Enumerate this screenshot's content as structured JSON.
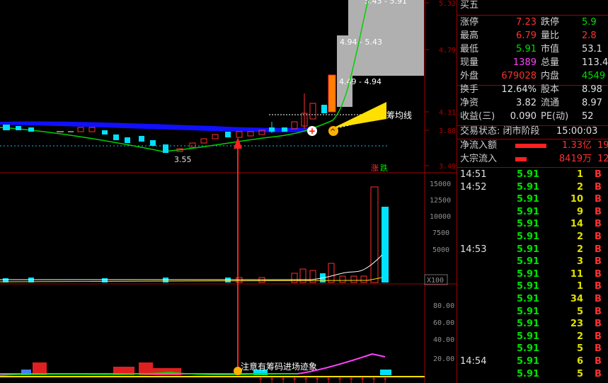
{
  "chart": {
    "price_axis": [
      "5.32",
      "4.79",
      "4.31",
      "3.88",
      "3.49"
    ],
    "volume_axis": [
      "15000",
      "12500",
      "10000",
      "7500",
      "5000",
      "X100"
    ],
    "indicator_axis": [
      "80.00",
      "60.00",
      "40.00",
      "20.00"
    ],
    "annot_range1": "4.94 - 5.43",
    "annot_range2": "4.49 - 4.94",
    "annot_range3": "5.43 - 5.91",
    "annot_cost_line": "筹均线",
    "annot_low": "3.55",
    "annot_tag_up": "涨",
    "annot_tag_down": "跌",
    "annot_bottom": "注意有筹码进场迹象",
    "colors": {
      "up": "#ff3030",
      "down": "#00e0ff",
      "ma_blue": "#0000ff",
      "cost_yellow": "#ffe000",
      "grid": "#a00000"
    }
  },
  "quote": {
    "header": "买五",
    "rows": [
      {
        "l1": "涨停",
        "v1": "7.23",
        "c1": "red",
        "l2": "跌停",
        "v2": "5.9",
        "c2": "green"
      },
      {
        "l1": "最高",
        "v1": "6.79",
        "c1": "red",
        "l2": "量比",
        "v2": "2.8",
        "c2": "red"
      },
      {
        "l1": "最低",
        "v1": "5.91",
        "c1": "green",
        "l2": "市值",
        "v2": "53.1",
        "c2": "white"
      },
      {
        "l1": "现量",
        "v1": "1389",
        "c1": "magenta",
        "l2": "总量",
        "v2": "113.4",
        "c2": "white"
      },
      {
        "l1": "外盘",
        "v1": "679028",
        "c1": "red",
        "l2": "内盘",
        "v2": "4549",
        "c2": "green"
      }
    ],
    "rows2": [
      {
        "l1": "换手",
        "v1": "12.64%",
        "c1": "white",
        "l2": "股本",
        "v2": "8.98",
        "c2": "white"
      },
      {
        "l1": "净资",
        "v1": "3.82",
        "c1": "white",
        "l2": "流通",
        "v2": "8.97",
        "c2": "white"
      },
      {
        "l1": "收益(三)",
        "v1": "0.090",
        "c1": "white",
        "l2": "PE(动)",
        "v2": "52",
        "c2": "white"
      }
    ],
    "status_label": "交易状态: 闭市阶段",
    "status_time": "15:00:03",
    "netflow_label": "净流入额",
    "netflow_value": "1.33亿",
    "netflow_extra": "19",
    "block_label": "大宗流入",
    "block_value": "8419万",
    "block_extra": "12"
  },
  "ticks": [
    {
      "time": "14:51",
      "price": "5.91",
      "vol": "1",
      "dir": "B"
    },
    {
      "time": "14:52",
      "price": "5.91",
      "vol": "2",
      "dir": "B"
    },
    {
      "time": "",
      "price": "5.91",
      "vol": "10",
      "dir": "B"
    },
    {
      "time": "",
      "price": "5.91",
      "vol": "9",
      "dir": "B"
    },
    {
      "time": "",
      "price": "5.91",
      "vol": "14",
      "dir": "B"
    },
    {
      "time": "",
      "price": "5.91",
      "vol": "2",
      "dir": "B"
    },
    {
      "time": "14:53",
      "price": "5.91",
      "vol": "2",
      "dir": "B"
    },
    {
      "time": "",
      "price": "5.91",
      "vol": "3",
      "dir": "B"
    },
    {
      "time": "",
      "price": "5.91",
      "vol": "11",
      "dir": "B"
    },
    {
      "time": "",
      "price": "5.91",
      "vol": "1",
      "dir": "B"
    },
    {
      "time": "",
      "price": "5.91",
      "vol": "34",
      "dir": "B"
    },
    {
      "time": "",
      "price": "5.91",
      "vol": "5",
      "dir": "B"
    },
    {
      "time": "",
      "price": "5.91",
      "vol": "23",
      "dir": "B"
    },
    {
      "time": "",
      "price": "5.91",
      "vol": "2",
      "dir": "B"
    },
    {
      "time": "",
      "price": "5.91",
      "vol": "5",
      "dir": "B"
    },
    {
      "time": "14:54",
      "price": "5.91",
      "vol": "6",
      "dir": "B"
    },
    {
      "time": "",
      "price": "5.91",
      "vol": "5",
      "dir": "B"
    }
  ]
}
